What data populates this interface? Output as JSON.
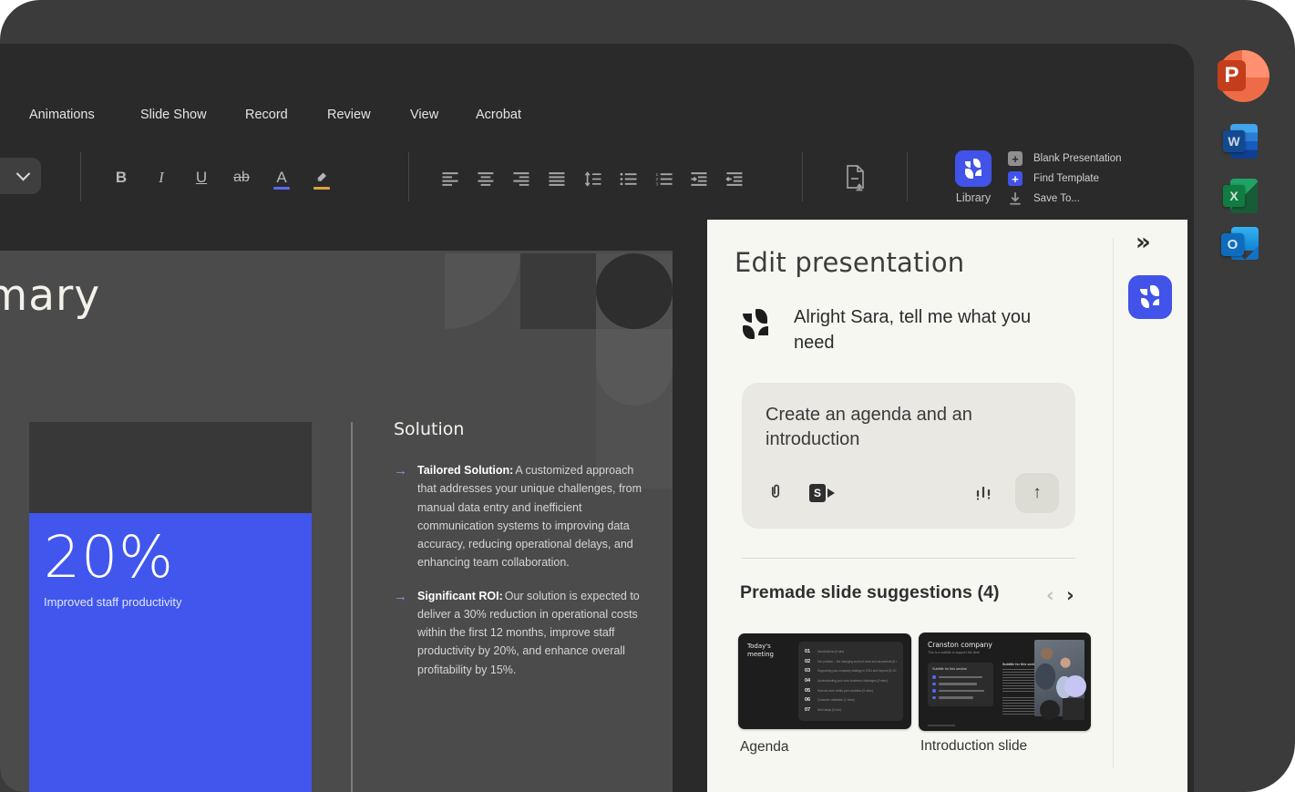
{
  "ribbon": {
    "tabs": [
      "Animations",
      "Slide Show",
      "Record",
      "Review",
      "View",
      "Acrobat"
    ],
    "format": {
      "bold": "B",
      "italic": "I",
      "underline": "U",
      "strikethrough": "ab",
      "font_color": "A"
    },
    "library_label": "Library",
    "quick_actions": [
      {
        "label": "Blank Presentation"
      },
      {
        "label": "Find Template"
      },
      {
        "label": "Save To..."
      }
    ]
  },
  "dock": {
    "powerpoint": "P",
    "word": "W",
    "excel": "X",
    "outlook": "O"
  },
  "slide": {
    "title": "Summary",
    "stat": {
      "value": "20%",
      "label": "Improved staff productivity"
    },
    "section": {
      "heading": "Solution",
      "bullets": [
        {
          "lead": "Tailored Solution:",
          "text": "A customized approach that addresses your unique challenges, from manual data  entry and inefficient communication systems to improving data accuracy, reducing operational  delays, and enhancing team collaboration."
        },
        {
          "lead": "Significant ROI:",
          "text": "Our solution is expected to deliver a 30% reduction in operational costs within the first 12 months, improve staff productivity by 20%, and enhance overall profitability by 15%."
        }
      ]
    }
  },
  "panel": {
    "title": "Edit presentation",
    "assistant_message": "Alright Sara, tell me what you need",
    "prompt_value": "Create an agenda and an introduction",
    "suggestions_heading": "Premade slide suggestions (4)",
    "thumbnails": [
      {
        "label": "Agenda",
        "slide_title": "Today's meeting",
        "rows": [
          {
            "n": "01",
            "t": "Introductions (5 min)"
          },
          {
            "n": "02",
            "t": "Our position – the changing world of work and documents (5 mins)"
          },
          {
            "n": "03",
            "t": "Supporting your company strategy in 2024 and beyond (5-10 mins)"
          },
          {
            "n": "04",
            "t": "Understanding your core business challenges (5 mins)"
          },
          {
            "n": "05",
            "t": "How we work within your workflow (5 mins)"
          },
          {
            "n": "06",
            "t": "Customer validation (2 mins)"
          },
          {
            "n": "07",
            "t": "Next steps (5 min)"
          }
        ]
      },
      {
        "label": "Introduction slide",
        "slide_title": "Cranston company",
        "slide_subtitle": "This is a subtitle to support the slide",
        "card_heading": "Subtitle for this section",
        "body_heading": "Subtitle for this section"
      }
    ]
  },
  "icons": {
    "plus": "+",
    "collapse": "»",
    "prev": "‹",
    "next": "›",
    "send": "↑",
    "bullet_arrow": "→"
  },
  "colors": {
    "accent_blue": "#4153E8",
    "slide_blue": "#4156EC",
    "panel_bg": "#F7F7F2",
    "window_bg": "#2A2A2A",
    "backdrop": "#3B3B3B",
    "slide_bg": "#4B4B4B",
    "font_color_underline": "#5B6BF0",
    "highlight_yellow": "#D9A43A"
  }
}
